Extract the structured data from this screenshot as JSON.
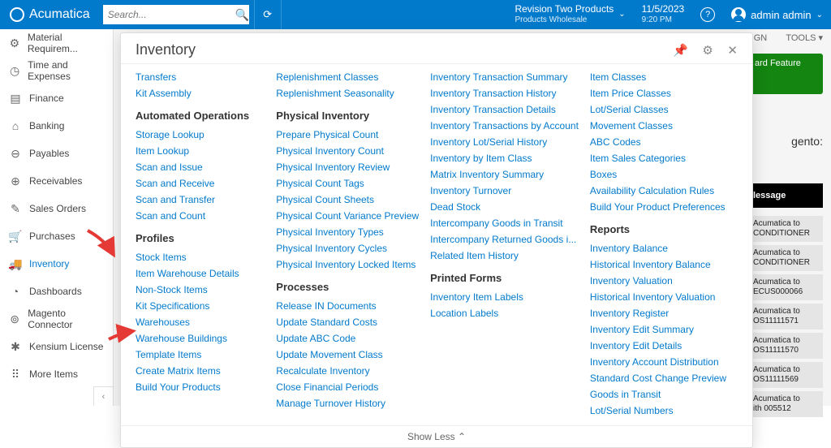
{
  "top": {
    "logo": "Acumatica",
    "search_placeholder": "Search...",
    "tenant": "Revision Two Products",
    "tenant_sub": "Products Wholesale",
    "date": "11/5/2023",
    "time": "9:20 PM",
    "user": "admin admin"
  },
  "sidebar": {
    "items": [
      {
        "icon": "⚙",
        "label": "Material Requirem..."
      },
      {
        "icon": "◷",
        "label": "Time and Expenses"
      },
      {
        "icon": "▤",
        "label": "Finance"
      },
      {
        "icon": "⌂",
        "label": "Banking"
      },
      {
        "icon": "⊖",
        "label": "Payables"
      },
      {
        "icon": "⊕",
        "label": "Receivables"
      },
      {
        "icon": "✎",
        "label": "Sales Orders"
      },
      {
        "icon": "🛒",
        "label": "Purchases"
      },
      {
        "icon": "🚚",
        "label": "Inventory"
      },
      {
        "icon": "◔",
        "label": "Dashboards"
      },
      {
        "icon": "⊚",
        "label": "Magento Connector"
      },
      {
        "icon": "✱",
        "label": "Kensium License"
      },
      {
        "icon": "⠿",
        "label": "More Items"
      }
    ]
  },
  "mega": {
    "title": "Inventory",
    "show_less": "Show Less",
    "col1": {
      "links_a": [
        "Transfers",
        "Kit Assembly"
      ],
      "h_auto": "Automated Operations",
      "links_auto": [
        "Storage Lookup",
        "Item Lookup",
        "Scan and Issue",
        "Scan and Receive",
        "Scan and Transfer",
        "Scan and Count"
      ],
      "h_prof": "Profiles",
      "links_prof": [
        "Stock Items",
        "Item Warehouse Details",
        "Non-Stock Items",
        "Kit Specifications",
        "Warehouses",
        "Warehouse Buildings",
        "Template Items",
        "Create Matrix Items",
        "Build Your Products"
      ]
    },
    "col2": {
      "links_a": [
        "Replenishment Classes",
        "Replenishment Seasonality"
      ],
      "h_phys": "Physical Inventory",
      "links_phys": [
        "Prepare Physical Count",
        "Physical Inventory Count",
        "Physical Inventory Review",
        "Physical Count Tags",
        "Physical Count Sheets",
        "Physical Count Variance Preview",
        "Physical Inventory Types",
        "Physical Inventory Cycles",
        "Physical Inventory Locked Items"
      ],
      "h_proc": "Processes",
      "links_proc": [
        "Release IN Documents",
        "Update Standard Costs",
        "Update ABC Code",
        "Update Movement Class",
        "Recalculate Inventory",
        "Close Financial Periods",
        "Manage Turnover History"
      ]
    },
    "col3": {
      "links_a": [
        "Inventory Transaction Summary",
        "Inventory Transaction History",
        "Inventory Transaction Details",
        "Inventory Transactions by Account",
        "Inventory Lot/Serial History",
        "Inventory by Item Class",
        "Matrix Inventory Summary",
        "Inventory Turnover",
        "Dead Stock",
        "Intercompany Goods in Transit",
        "Intercompany Returned Goods i...",
        "Related Item History"
      ],
      "h_print": "Printed Forms",
      "links_print": [
        "Inventory Item Labels",
        "Location Labels"
      ]
    },
    "col4": {
      "links_a": [
        "Item Classes",
        "Item Price Classes",
        "Lot/Serial Classes",
        "Movement Classes",
        "ABC Codes",
        "Item Sales Categories",
        "Boxes",
        "Availability Calculation Rules",
        "Build Your Product Preferences"
      ],
      "h_rep": "Reports",
      "links_rep": [
        "Inventory Balance",
        "Historical Inventory Balance",
        "Inventory Valuation",
        "Historical Inventory Valuation",
        "Inventory Register",
        "Inventory Edit Summary",
        "Inventory Edit Details",
        "Inventory Account Distribution",
        "Standard Cost Change Preview",
        "Goods in Transit",
        "Lot/Serial Numbers"
      ]
    }
  },
  "bg": {
    "design": "DESIGN",
    "tools": "TOOLS",
    "green": "ard Feature",
    "mag": "gento:",
    "black": "lessage",
    "rows": [
      {
        "a": "Acumatica to",
        "b": "CONDITIONER"
      },
      {
        "a": "Acumatica to",
        "b": "CONDITIONER"
      },
      {
        "a": "Acumatica to",
        "b": "ECUS000066"
      },
      {
        "a": "Acumatica to",
        "b": "OS11111571"
      },
      {
        "a": "Acumatica to",
        "b": "OS11111570"
      },
      {
        "a": "Acumatica to",
        "b": "OS11111569"
      },
      {
        "a": "Acumatica to",
        "b": "ith 005512"
      }
    ]
  }
}
